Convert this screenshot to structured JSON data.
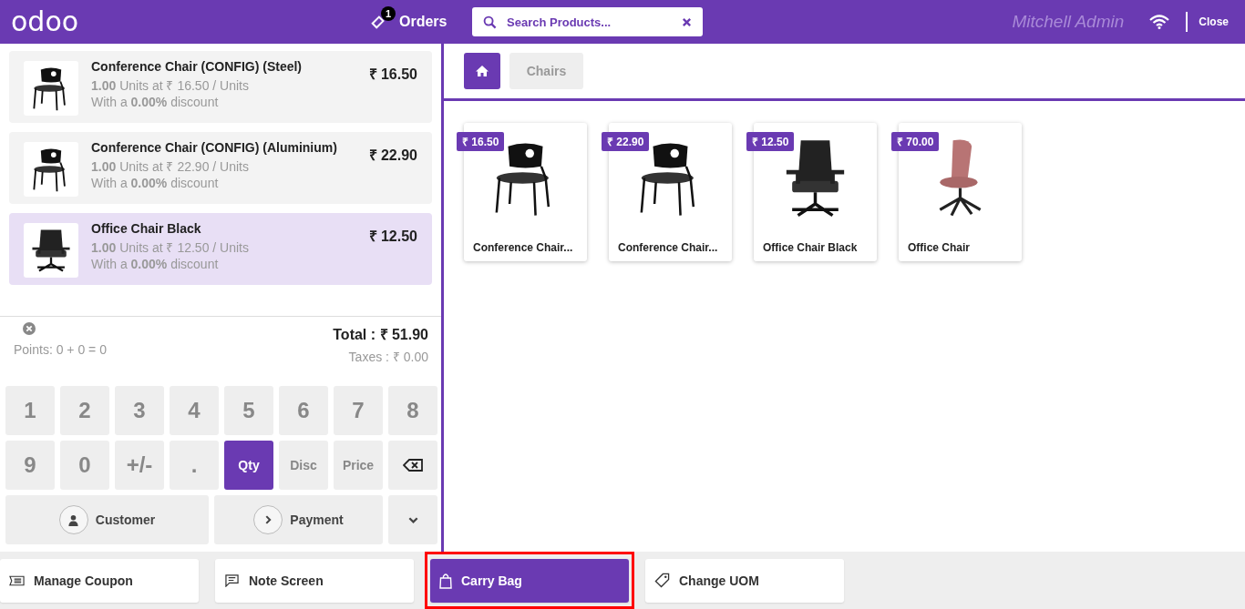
{
  "header": {
    "logo": "odoo",
    "orders": {
      "label": "Orders",
      "count": "1"
    },
    "search": {
      "placeholder": "Search Products..."
    },
    "user": "Mitchell Admin",
    "close": "Close"
  },
  "orderlines": [
    {
      "name": "Conference Chair (CONFIG) (Steel)",
      "price": "₹ 16.50",
      "qty": "1.00",
      "info": "Units at ₹ 16.50 / Units",
      "discount": "With a **0.00%** discount",
      "selected": false
    },
    {
      "name": "Conference Chair (CONFIG) (Aluminium)",
      "price": "₹ 22.90",
      "qty": "1.00",
      "info": "Units at ₹ 22.90 / Units",
      "discount": "With a **0.00%** discount",
      "selected": false
    },
    {
      "name": "Office Chair Black",
      "price": "₹ 12.50",
      "qty": "1.00",
      "info": "Units at ₹ 12.50 / Units",
      "discount": "With a **0.00%** discount",
      "selected": true
    }
  ],
  "summary": {
    "points": "Points: 0 + 0 = 0",
    "total": "Total : ₹ 51.90",
    "taxes": "Taxes : ₹ 0.00"
  },
  "numpad": [
    {
      "kind": "digit",
      "label": "1",
      "selected": false
    },
    {
      "kind": "digit",
      "label": "2",
      "selected": false
    },
    {
      "kind": "digit",
      "label": "3",
      "selected": false
    },
    {
      "kind": "digit",
      "label": "4",
      "selected": false
    },
    {
      "kind": "digit",
      "label": "5",
      "selected": false
    },
    {
      "kind": "digit",
      "label": "6",
      "selected": false
    },
    {
      "kind": "digit",
      "label": "7",
      "selected": false
    },
    {
      "kind": "digit",
      "label": "8",
      "selected": false
    },
    {
      "kind": "digit",
      "label": "9",
      "selected": false
    },
    {
      "kind": "digit",
      "label": "0",
      "selected": false
    },
    {
      "kind": "digit",
      "label": "+/-",
      "selected": false
    },
    {
      "kind": "digit",
      "label": ".",
      "selected": false
    },
    {
      "kind": "mode",
      "label": "Qty",
      "selected": true
    },
    {
      "kind": "mode",
      "label": "Disc",
      "selected": false
    },
    {
      "kind": "mode",
      "label": "Price",
      "selected": false
    },
    {
      "kind": "backspace",
      "selected": false
    }
  ],
  "actions": [
    {
      "kind": "customer",
      "label": "Customer"
    },
    {
      "kind": "payment",
      "label": "Payment"
    },
    {
      "kind": "more"
    }
  ],
  "breadcrumb": {
    "category": "Chairs"
  },
  "products": [
    {
      "name": "Conference Chair...",
      "price": "₹ 16.50"
    },
    {
      "name": "Conference Chair...",
      "price": "₹ 22.90"
    },
    {
      "name": "Office Chair Black",
      "price": "₹ 12.50"
    },
    {
      "name": "Office Chair",
      "price": "₹ 70.00"
    }
  ],
  "control_buttons": [
    {
      "kind": "coupon",
      "label": "Manage Coupon",
      "selected": false,
      "highlighted": false
    },
    {
      "kind": "note",
      "label": "Note Screen",
      "selected": false,
      "highlighted": false
    },
    {
      "kind": "bag",
      "label": "Carry Bag",
      "selected": true,
      "highlighted": true
    },
    {
      "kind": "tag",
      "label": "Change UOM",
      "selected": false,
      "highlighted": false
    }
  ]
}
